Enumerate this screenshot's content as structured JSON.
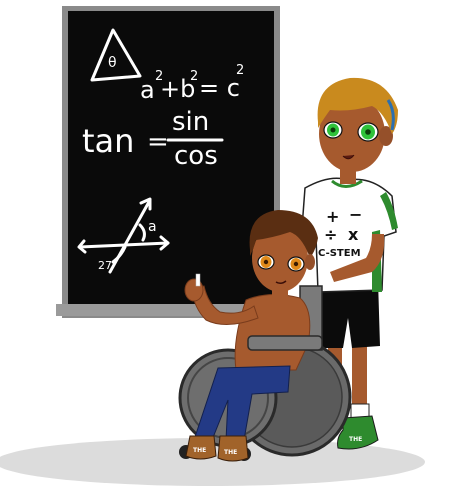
{
  "chalkboard": {
    "equations": {
      "triangle_angle": "θ",
      "pythagorean_a": "a",
      "pythagorean_a_exp": "2",
      "pythagorean_plus": "+b",
      "pythagorean_b_exp": "2",
      "pythagorean_eq": "= c",
      "pythagorean_c_exp": "2",
      "tan_label": "tan",
      "tan_equals": "=",
      "sin_label": "sin",
      "cos_label": "cos",
      "angle_a": "a",
      "angle_27": "27°"
    }
  },
  "shirt": {
    "plus": "+",
    "minus": "−",
    "divide": "÷",
    "times": "x",
    "stem_label": "C-STEM"
  },
  "shoes": {
    "left_text": "THE",
    "right_text": "THE",
    "standing_text": "THE"
  },
  "colors": {
    "board": "#0a0a0a",
    "board_frame": "#8a8a8a",
    "skin": "#a65a2e",
    "hair_blonde": "#c98a1e",
    "hair_brown": "#5a2e12",
    "eyes_green": "#2fc23a",
    "eyes_amber": "#e08a1a",
    "shirt_green": "#2e8b2e",
    "pants_blue": "#233a86",
    "wheel_gray": "#5a5a5a",
    "shadow": "#d9d9d9"
  }
}
